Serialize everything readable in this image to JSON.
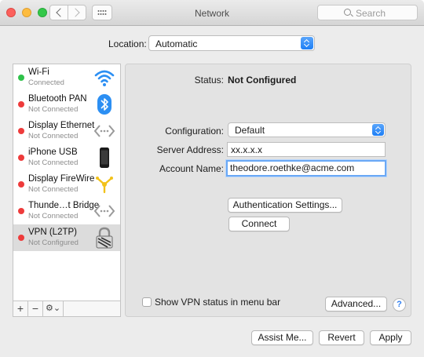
{
  "window": {
    "title": "Network"
  },
  "search": {
    "placeholder": "Search"
  },
  "location": {
    "label": "Location:",
    "value": "Automatic"
  },
  "services": [
    {
      "name": "Wi-Fi",
      "status": "Connected",
      "status_color": "#2fc24a",
      "icon": "wifi-icon"
    },
    {
      "name": "Bluetooth PAN",
      "status": "Not Connected",
      "status_color": "#ee3b3b",
      "icon": "bluetooth-icon"
    },
    {
      "name": "Display Ethernet",
      "status": "Not Connected",
      "status_color": "#ee3b3b",
      "icon": "ethernet-icon"
    },
    {
      "name": "iPhone USB",
      "status": "Not Connected",
      "status_color": "#ee3b3b",
      "icon": "iphone-icon"
    },
    {
      "name": "Display FireWire",
      "status": "Not Connected",
      "status_color": "#ee3b3b",
      "icon": "firewire-icon"
    },
    {
      "name": "Thunde…t Bridge",
      "status": "Not Connected",
      "status_color": "#ee3b3b",
      "icon": "thunderbolt-bridge-icon"
    },
    {
      "name": "VPN (L2TP)",
      "status": "Not Configured",
      "status_color": "#ee3b3b",
      "icon": "vpn-lock-icon",
      "selected": true
    }
  ],
  "sidebar_toolbar": {
    "add": "+",
    "remove": "−",
    "gear": "⚙⌄"
  },
  "detail": {
    "status_label": "Status:",
    "status_value": "Not Configured",
    "configuration_label": "Configuration:",
    "configuration_value": "Default",
    "server_address_label": "Server Address:",
    "server_address_value": "xx.x.x.x",
    "account_name_label": "Account Name:",
    "account_name_value": "theodore.roethke@acme.com",
    "auth_button": "Authentication Settings...",
    "connect_button": "Connect",
    "show_vpn_status_label": "Show VPN status in menu bar",
    "show_vpn_status_checked": false,
    "advanced_button": "Advanced...",
    "help_button": "?"
  },
  "footer": {
    "assist_button": "Assist Me...",
    "revert_button": "Revert",
    "apply_button": "Apply"
  }
}
